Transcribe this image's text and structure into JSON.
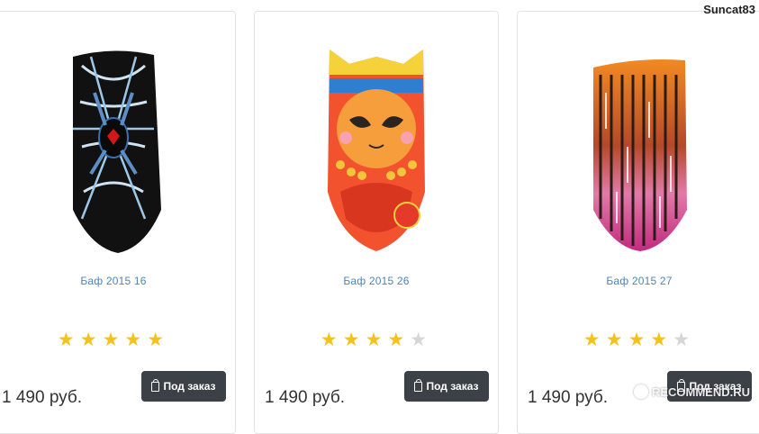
{
  "header": {
    "username": "Suncat83"
  },
  "products": [
    {
      "title": "Баф 2015 16",
      "rating": 5,
      "max_rating": 5,
      "price": "1 490 руб.",
      "button_label": "Под заказ"
    },
    {
      "title": "Баф 2015 26",
      "rating": 4,
      "max_rating": 5,
      "price": "1 490 руб.",
      "button_label": "Под заказ"
    },
    {
      "title": "Баф 2015 27",
      "rating": 4,
      "max_rating": 5,
      "price": "1 490 руб.",
      "button_label": "Под заказ"
    }
  ],
  "watermark": {
    "text": "RECOMMEND.RU"
  },
  "colors": {
    "star_on": "#f5c21b",
    "star_off": "#d6d6d6",
    "title_link": "#4a86b8",
    "button_bg": "#3b4146"
  },
  "icons": {
    "star": "star-icon",
    "button": "shopping-bag-icon"
  }
}
